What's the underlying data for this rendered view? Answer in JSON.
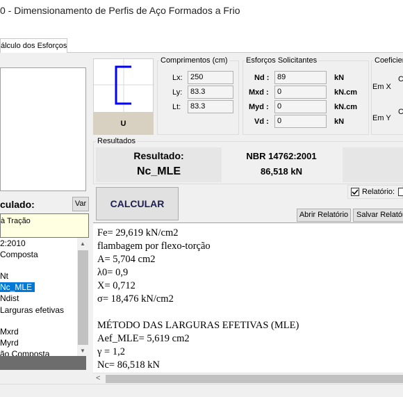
{
  "window": {
    "title": "0 - Dimensionamento de Perfis de Aço Formados a Frio"
  },
  "tabs": [
    {
      "label": "álculo dos Esforços"
    }
  ],
  "section": {
    "label": "U"
  },
  "comprimentos": {
    "title": "Comprimentos (cm)",
    "lx_label": "Lx:",
    "lx_value": "250",
    "ly_label": "Ly:",
    "ly_value": "83.3",
    "lt_label": "Lt:",
    "lt_value": "83.3"
  },
  "esforcos": {
    "title": "Esforços Solicitantes",
    "nd_label": "Nd :",
    "nd_value": "89",
    "nd_unit": "kN",
    "mxd_label": "Mxd :",
    "mxd_value": "0",
    "mxd_unit": "kN.cm",
    "myd_label": "Myd :",
    "myd_value": "0",
    "myd_unit": "kN.cm",
    "vd_label": "Vd :",
    "vd_value": "0",
    "vd_unit": "kN"
  },
  "coef": {
    "title": "Coeficier",
    "emx": "Em X",
    "emy": "Em Y",
    "c1": "C",
    "c2": "C"
  },
  "resultados": {
    "title": "Resultados",
    "resultado_label": "Resultado:",
    "resultado_value": "Nc_MLE",
    "norma": "NBR 14762:2001",
    "norma_value": "86,518 kN"
  },
  "left": {
    "calculado_label": "culado:",
    "var_button": "Var",
    "selected_box": "à Tração",
    "list": [
      "2:2010",
      "Composta",
      "",
      "Nt",
      "Nc_MLE",
      "Ndist",
      "Larguras efetivas",
      "",
      "Mxrd",
      "Myrd",
      "ão Composta"
    ],
    "selected_item": "Nc_MLE"
  },
  "calcular_button": "CALCULAR",
  "relatorio_label": "Relatório:",
  "abrir_relatorio_button": "Abrir Relatório",
  "salvar_relatorio_button": "Salvar Relatór",
  "output_lines": [
    "Fe= 29,619 kN/cm2",
    "flambagem por flexo-torção",
    "A= 5,704 cm2",
    "λ0= 0,9",
    "X= 0,712",
    "σ= 18,476 kN/cm2",
    "",
    "MÉTODO DAS LARGURAS EFETIVAS (MLE)",
    "Aef_MLE= 5,619 cm2",
    "γ = 1,2",
    "Nc= 86,518 kN"
  ],
  "colors": {
    "selection": "#0078d7",
    "profile": "#0000ff",
    "results_bg": "#e6e6e6"
  }
}
